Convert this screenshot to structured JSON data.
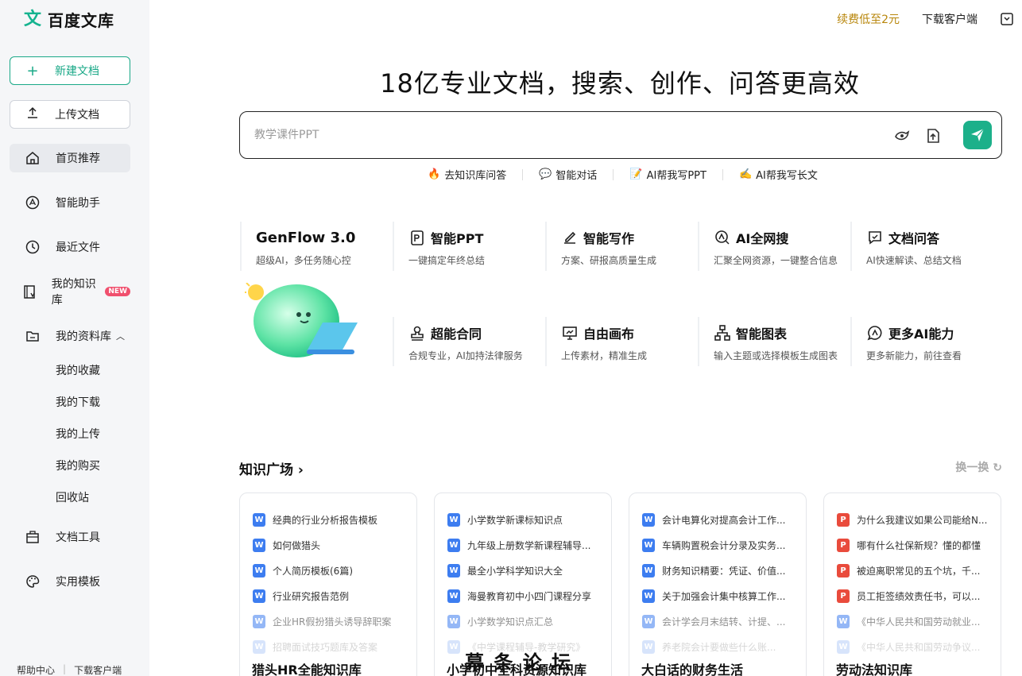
{
  "brand": {
    "logo_glyph": "文",
    "name": "百度文库"
  },
  "sidebar": {
    "new_doc": "新建文档",
    "upload_doc": "上传文档",
    "nav": [
      {
        "label": "首页推荐",
        "icon": "home-icon"
      },
      {
        "label": "智能助手",
        "icon": "ai-assistant-icon"
      },
      {
        "label": "最近文件",
        "icon": "clock-icon"
      },
      {
        "label": "我的知识库",
        "icon": "knowledge-base-icon",
        "badge": "NEW"
      },
      {
        "label": "我的资料库",
        "icon": "folder-icon"
      },
      {
        "label": "文档工具",
        "icon": "toolbox-icon"
      },
      {
        "label": "实用模板",
        "icon": "palette-icon"
      }
    ],
    "sub": [
      "我的收藏",
      "我的下载",
      "我的上传",
      "我的购买",
      "回收站"
    ],
    "footer": [
      "帮助中心",
      "下载客户端"
    ]
  },
  "topbar": {
    "promo": "续费低至2元",
    "download": "下载客户端"
  },
  "hero": {
    "title": "18亿专业文档，搜索、创作、问答更高效",
    "search_placeholder": "教学课件PPT",
    "quick": [
      "去知识库问答",
      "智能对话",
      "AI帮我写PPT",
      "AI帮我写长文"
    ]
  },
  "features": [
    {
      "title": "GenFlow 3.0",
      "desc": "超级AI，多任务随心控"
    },
    {
      "title": "智能PPT",
      "desc": "一键搞定年终总结"
    },
    {
      "title": "智能写作",
      "desc": "方案、研报高质量生成"
    },
    {
      "title": "AI全网搜",
      "desc": "汇聚全网资源，一键整合信息"
    },
    {
      "title": "文档问答",
      "desc": "AI快速解读、总结文档"
    },
    {
      "title": "超能合同",
      "desc": "合规专业，AI加持法律服务"
    },
    {
      "title": "自由画布",
      "desc": "上传素材，精准生成"
    },
    {
      "title": "智能图表",
      "desc": "输入主题或选择模板生成图表"
    },
    {
      "title": "更多AI能力",
      "desc": "更多新能力，前往查看"
    }
  ],
  "knowledge": {
    "title": "知识广场",
    "refresh": "换一换",
    "cards": [
      {
        "title": "猎头HR全能知识库",
        "items": [
          {
            "type": "W",
            "text": "经典的行业分析报告模板"
          },
          {
            "type": "W",
            "text": "如何做猎头"
          },
          {
            "type": "W",
            "text": "个人简历模板(6篇)"
          },
          {
            "type": "W",
            "text": "行业研究报告范例"
          },
          {
            "type": "W",
            "text": "企业HR假扮猎头诱导辞职案"
          },
          {
            "type": "W",
            "text": "招聘面试技巧题库及答案"
          }
        ]
      },
      {
        "title": "小学初中全科资源知识库",
        "items": [
          {
            "type": "W",
            "text": "小学数学新课标知识点"
          },
          {
            "type": "W",
            "text": "九年级上册数学新课程辅导..."
          },
          {
            "type": "W",
            "text": "最全小学科学知识大全"
          },
          {
            "type": "W",
            "text": "海曼教育初中小四门课程分享"
          },
          {
            "type": "W",
            "text": "小学数学知识点汇总"
          },
          {
            "type": "W",
            "text": "《中学课程辅导-教学研究》"
          }
        ]
      },
      {
        "title": "大白话的财务生活",
        "items": [
          {
            "type": "W",
            "text": "会计电算化对提高会计工作..."
          },
          {
            "type": "W",
            "text": "车辆购置税会计分录及实务..."
          },
          {
            "type": "W",
            "text": "财务知识精要：凭证、价值..."
          },
          {
            "type": "W",
            "text": "关于加强会计集中核算工作..."
          },
          {
            "type": "W",
            "text": "会计学会月末结转、计提、..."
          },
          {
            "type": "W",
            "text": "养老院会计要做些什么账..."
          }
        ]
      },
      {
        "title": "劳动法知识库",
        "items": [
          {
            "type": "P",
            "text": "为什么我建议如果公司能给N..."
          },
          {
            "type": "P",
            "text": "哪有什么社保新规？懂的都懂"
          },
          {
            "type": "P",
            "text": "被迫离职常见的五个坑，千..."
          },
          {
            "type": "P",
            "text": "员工拒签绩效责任书，可以..."
          },
          {
            "type": "W",
            "text": "《中华人民共和国劳动就业..."
          },
          {
            "type": "W",
            "text": "《中华人民共和国劳动争议..."
          }
        ]
      }
    ]
  },
  "watermark": "幕 条 论 坛"
}
